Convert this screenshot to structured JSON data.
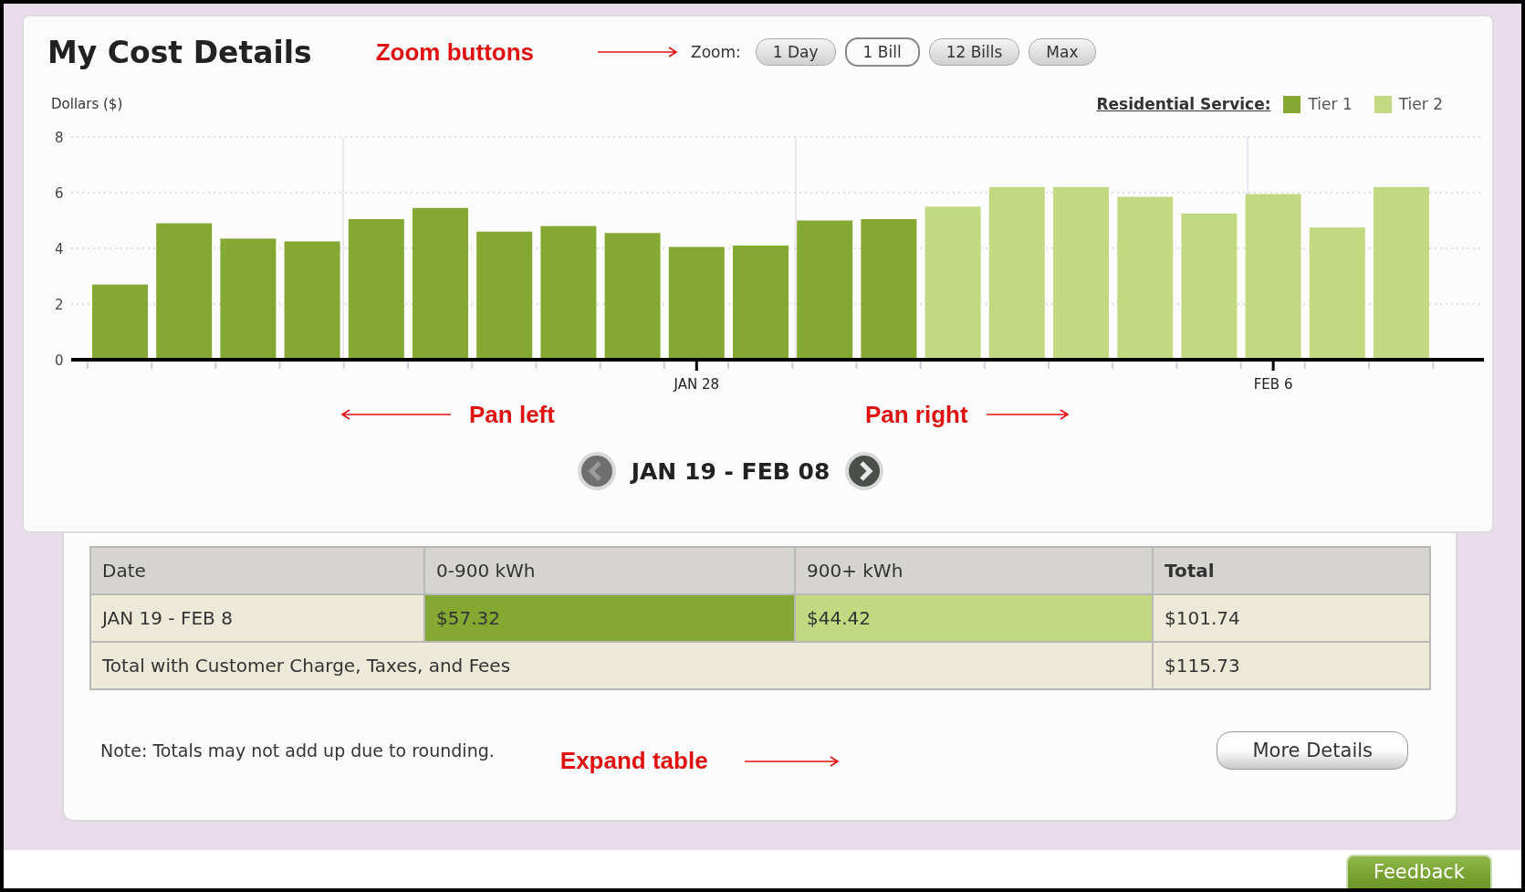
{
  "title": "My Cost Details",
  "zoom": {
    "label": "Zoom:",
    "buttons": [
      {
        "label": "1 Day",
        "selected": false
      },
      {
        "label": "1 Bill",
        "selected": true
      },
      {
        "label": "12 Bills",
        "selected": false
      },
      {
        "label": "Max",
        "selected": false
      }
    ]
  },
  "legend_title": "Residential Service:",
  "chart_data": {
    "type": "bar",
    "ylabel": "Dollars ($)",
    "stacked": true,
    "categories": [
      null,
      null,
      null,
      null,
      null,
      null,
      null,
      null,
      null,
      "JAN 28",
      null,
      null,
      null,
      null,
      null,
      null,
      null,
      null,
      "FEB 6",
      null,
      null
    ],
    "ylim": [
      0,
      8
    ],
    "grid": true,
    "yticks": [
      {
        "value": 0,
        "label": "0"
      },
      {
        "value": 2,
        "label": "2"
      },
      {
        "value": 4,
        "label": "4"
      },
      {
        "value": 6,
        "label": "6"
      },
      {
        "value": 8,
        "label": "8"
      }
    ],
    "series": [
      {
        "name": "Tier 1",
        "color": "#84a832",
        "values": [
          2.7,
          4.9,
          4.35,
          4.25,
          5.05,
          5.45,
          4.6,
          4.8,
          4.55,
          4.05,
          4.1,
          5.0,
          5.05,
          null,
          null,
          null,
          null,
          null,
          null,
          null,
          null
        ]
      },
      {
        "name": "Tier 2",
        "color": "#c2d982",
        "values": [
          null,
          null,
          null,
          null,
          null,
          null,
          null,
          null,
          null,
          null,
          null,
          null,
          null,
          5.5,
          6.2,
          6.2,
          5.85,
          5.25,
          5.95,
          4.75,
          6.2
        ]
      }
    ]
  },
  "pager": {
    "range": "JAN 19 - FEB 08"
  },
  "table": {
    "columns": [
      "Date",
      "0-900 kWh",
      "900+ kWh",
      "Total"
    ],
    "rows": [
      {
        "cells": [
          {
            "text": "JAN 19 - FEB 8",
            "kind": "plain"
          },
          {
            "text": "$57.32",
            "kind": "tier1"
          },
          {
            "text": "$44.42",
            "kind": "tier2"
          },
          {
            "text": "$101.74",
            "kind": "plain"
          }
        ]
      },
      {
        "cells": [
          {
            "text": "Total with Customer Charge, Taxes, and Fees",
            "kind": "plain",
            "colspan": 3
          },
          {
            "text": "$115.73",
            "kind": "plain"
          }
        ]
      }
    ]
  },
  "note": "Note: Totals may not add up due to rounding.",
  "more_button": "More Details",
  "feedback_button": "Feedback",
  "annotations": [
    {
      "text": "Zoom buttons"
    },
    {
      "text": "Pan left"
    },
    {
      "text": "Pan right"
    },
    {
      "text": "Expand table"
    }
  ]
}
